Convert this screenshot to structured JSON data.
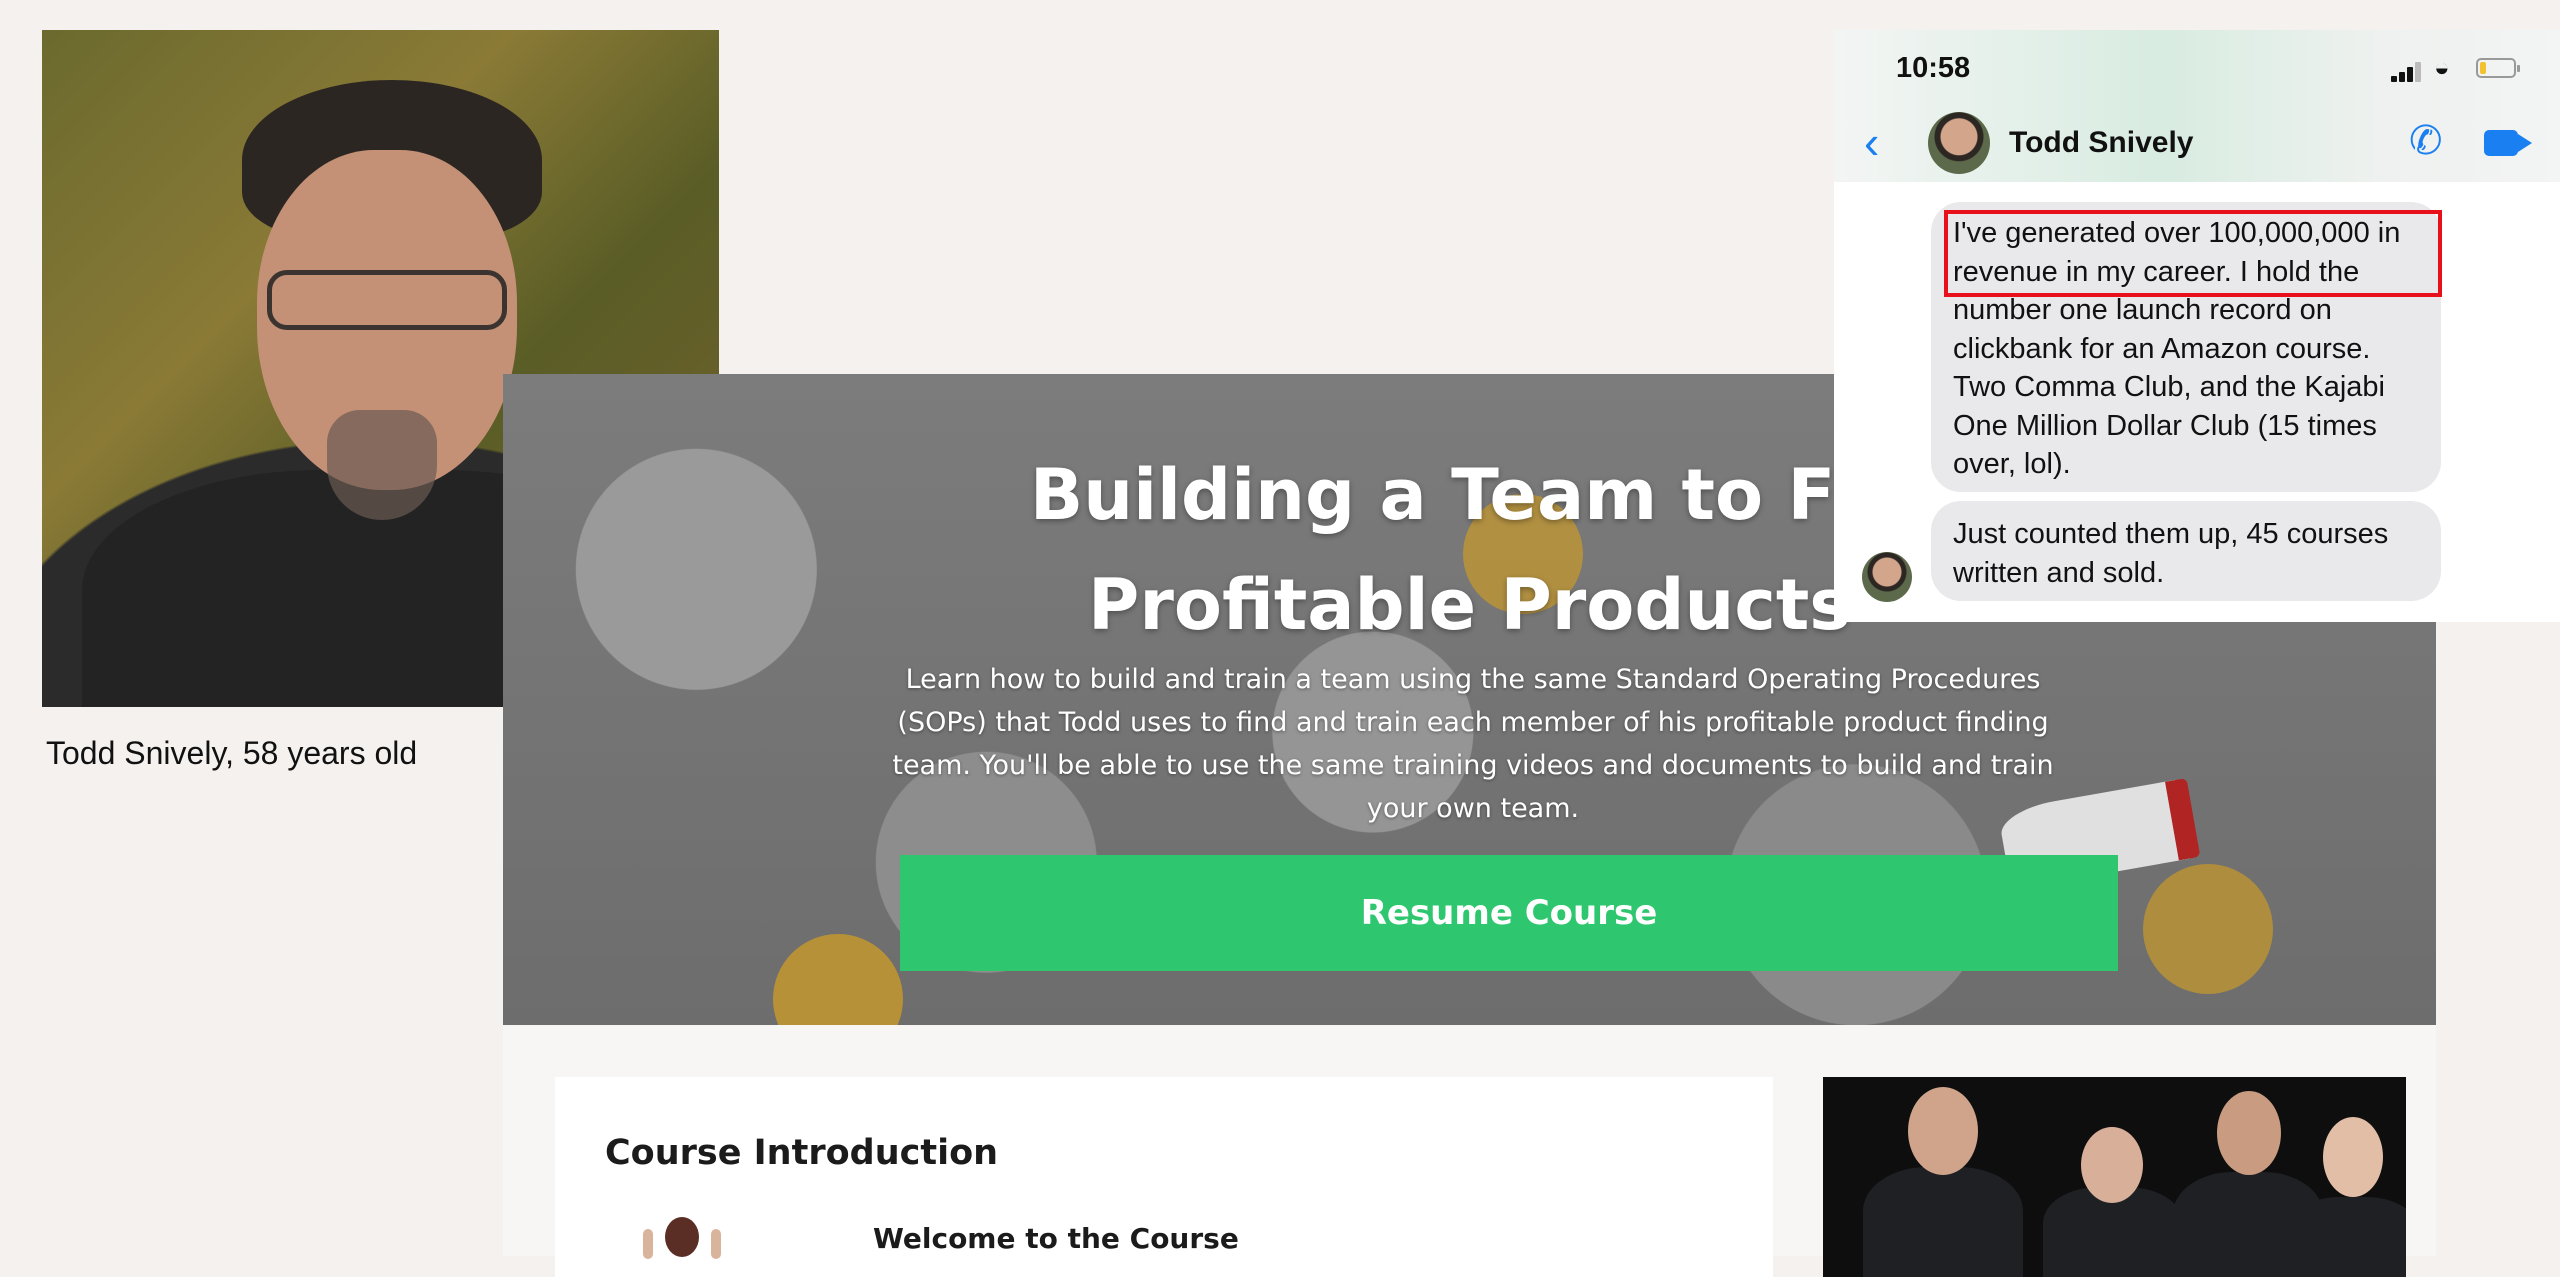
{
  "portrait": {
    "caption": "Todd Snively, 58 years old"
  },
  "hero": {
    "title_line1": "Building a Team to Fin",
    "title_line2": "Profitable Products",
    "description": "Learn how to build and train a team using the same Standard Operating Procedures (SOPs) that Todd uses to find and train each member of his profitable product finding team. You'll be able to use the same training videos and documents to build and train your own team.",
    "resume_label": "Resume Course"
  },
  "course": {
    "intro_title": "Course Introduction",
    "lesson_title": "Welcome to the Course"
  },
  "phone": {
    "time": "10:58",
    "contact_name": "Todd Snively",
    "messages": [
      "I've generated over 100,000,000 in revenue in my career.  I hold the number one launch record on clickbank for an Amazon course. Two Comma Club, and the Kajabi One Million Dollar Club (15 times over, lol).",
      "Just counted them up, 45 courses written and sold."
    ],
    "colors": {
      "accent": "#1a7ff0",
      "bubble": "#e9e9eb",
      "highlight": "#e8111b"
    },
    "battery_level": 0.2
  },
  "colors": {
    "resume_button": "#2ec66e"
  }
}
